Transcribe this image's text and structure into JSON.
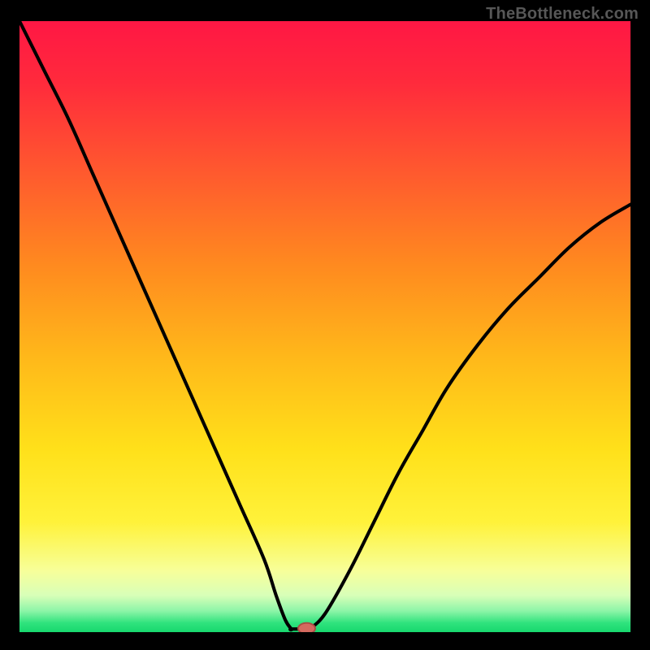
{
  "watermark": "TheBottleneck.com",
  "colors": {
    "background": "#000000",
    "curve": "#000000",
    "marker_fill": "#d46a5f",
    "marker_stroke": "#a84d44",
    "gradient_stops": [
      {
        "offset": 0.0,
        "color": "#ff1744"
      },
      {
        "offset": 0.1,
        "color": "#ff2a3c"
      },
      {
        "offset": 0.25,
        "color": "#ff5a2e"
      },
      {
        "offset": 0.4,
        "color": "#ff8a1f"
      },
      {
        "offset": 0.55,
        "color": "#ffb81a"
      },
      {
        "offset": 0.7,
        "color": "#ffe01a"
      },
      {
        "offset": 0.82,
        "color": "#fff23a"
      },
      {
        "offset": 0.9,
        "color": "#f7ff9a"
      },
      {
        "offset": 0.94,
        "color": "#d8ffb8"
      },
      {
        "offset": 0.965,
        "color": "#8ef5a8"
      },
      {
        "offset": 0.985,
        "color": "#2fe37d"
      },
      {
        "offset": 1.0,
        "color": "#18d86e"
      }
    ]
  },
  "chart_data": {
    "type": "line",
    "title": "",
    "xlabel": "",
    "ylabel": "",
    "xlim": [
      0,
      100
    ],
    "ylim": [
      0,
      100
    ],
    "series": [
      {
        "name": "bottleneck-curve-left",
        "x": [
          0,
          4,
          8,
          12,
          16,
          20,
          24,
          28,
          32,
          36,
          40,
          42,
          43.5,
          44.5
        ],
        "y": [
          100,
          92,
          84,
          75,
          66,
          57,
          48,
          39,
          30,
          21,
          12,
          6,
          2,
          0.5
        ]
      },
      {
        "name": "bottleneck-curve-flat",
        "x": [
          44.5,
          47.5
        ],
        "y": [
          0.5,
          0.5
        ]
      },
      {
        "name": "bottleneck-curve-right",
        "x": [
          47.5,
          50,
          54,
          58,
          62,
          66,
          70,
          75,
          80,
          85,
          90,
          95,
          100
        ],
        "y": [
          0.5,
          3,
          10,
          18,
          26,
          33,
          40,
          47,
          53,
          58,
          63,
          67,
          70
        ]
      }
    ],
    "marker": {
      "x": 47,
      "y": 0.6,
      "rx": 1.4,
      "ry": 0.9
    }
  }
}
